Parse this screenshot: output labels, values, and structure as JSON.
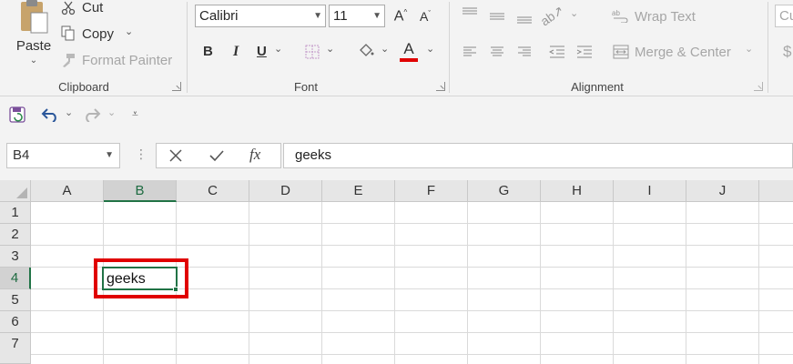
{
  "clipboard": {
    "paste_label": "Paste",
    "cut_label": "Cut",
    "copy_label": "Copy",
    "format_painter_label": "Format Painter",
    "group_label": "Clipboard"
  },
  "font": {
    "font_name": "Calibri",
    "font_size": "11",
    "bold_label": "B",
    "italic_label": "I",
    "underline_label": "U",
    "font_color_label": "A",
    "group_label": "Font",
    "font_color": "#e00000"
  },
  "alignment": {
    "wrap_text_label": "Wrap Text",
    "merge_center_label": "Merge & Center",
    "group_label": "Alignment"
  },
  "number": {
    "format_value": "Cu",
    "currency_symbol": "$"
  },
  "formula_bar": {
    "name_box": "B4",
    "fx_label": "fx",
    "content": "geeks"
  },
  "grid": {
    "columns": [
      "A",
      "B",
      "C",
      "D",
      "E",
      "F",
      "G",
      "H",
      "I",
      "J"
    ],
    "rows": [
      "1",
      "2",
      "3",
      "4",
      "5",
      "6",
      "7"
    ],
    "cells": {
      "B4": "geeks"
    },
    "selected_cell": "B4"
  },
  "colors": {
    "accent": "#217346",
    "highlight": "#e00000",
    "undo": "#2b579a"
  }
}
